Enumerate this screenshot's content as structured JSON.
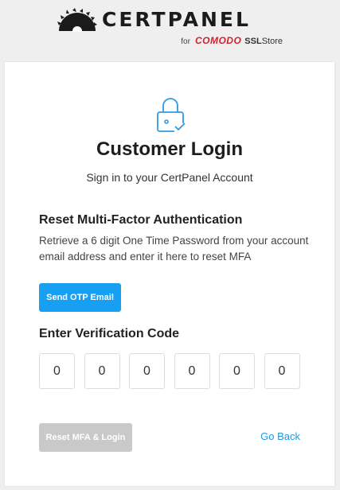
{
  "brand": {
    "name": "CERTPANEL",
    "for_text": "for",
    "comodo": "COMODO",
    "ssl": "SSL",
    "store": "Store"
  },
  "card": {
    "title": "Customer Login",
    "subtitle": "Sign in to your CertPanel Account",
    "section_title": "Reset Multi-Factor Authentication",
    "description": "Retrieve a 6 digit One Time Password from your account email address and enter it here to reset MFA",
    "send_otp_label": "Send OTP Email",
    "code_label": "Enter Verification Code",
    "code_digits": [
      "0",
      "0",
      "0",
      "0",
      "0",
      "0"
    ],
    "reset_label": "Reset MFA & Login",
    "go_back_label": "Go Back"
  },
  "icons": {
    "logo": "sawblade-logo-icon",
    "lock": "lock-check-icon"
  },
  "colors": {
    "primary": "#17a0f2",
    "disabled": "#c9c9c9",
    "link": "#1a9be8",
    "comodo_red": "#d51f2b"
  }
}
